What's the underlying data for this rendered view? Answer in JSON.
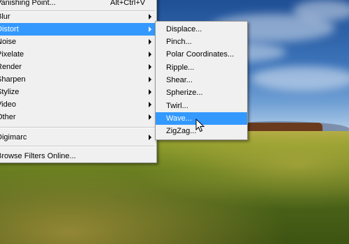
{
  "main_menu": {
    "top_partial": {
      "label": "Vanishing Point...",
      "shortcut": "Alt+Ctrl+V"
    },
    "items": [
      {
        "label": "Blur"
      },
      {
        "label": "Distort"
      },
      {
        "label": "Noise"
      },
      {
        "label": "Pixelate"
      },
      {
        "label": "Render"
      },
      {
        "label": "Sharpen"
      },
      {
        "label": "Stylize"
      },
      {
        "label": "Video"
      },
      {
        "label": "Other"
      },
      {
        "label": "Digimarc"
      },
      {
        "label": "Browse Filters Online..."
      }
    ],
    "selected": "Distort"
  },
  "submenu": {
    "items": [
      {
        "label": "Displace..."
      },
      {
        "label": "Pinch..."
      },
      {
        "label": "Polar Coordinates..."
      },
      {
        "label": "Ripple..."
      },
      {
        "label": "Shear..."
      },
      {
        "label": "Spherize..."
      },
      {
        "label": "Twirl..."
      },
      {
        "label": "Wave..."
      },
      {
        "label": "ZigZag..."
      }
    ],
    "selected": "Wave..."
  },
  "colors": {
    "highlight": "#3399ff",
    "menu_bg": "#f0f0f0"
  }
}
